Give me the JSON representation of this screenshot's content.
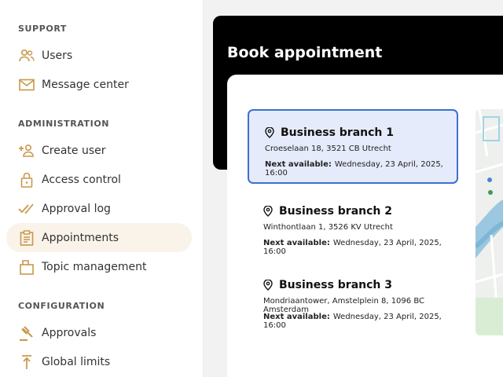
{
  "sidebar": {
    "sections": {
      "support": "SUPPORT",
      "administration": "ADMINISTRATION",
      "configuration": "CONFIGURATION"
    },
    "items": [
      {
        "label": "Users",
        "icon": "users-icon"
      },
      {
        "label": "Message center",
        "icon": "mail-icon"
      },
      {
        "label": "Create user",
        "icon": "add-user-icon"
      },
      {
        "label": "Access control",
        "icon": "lock-icon"
      },
      {
        "label": "Approval log",
        "icon": "double-check-icon"
      },
      {
        "label": "Appointments",
        "icon": "clipboard-icon"
      },
      {
        "label": "Topic management",
        "icon": "topic-icon"
      },
      {
        "label": "Approvals",
        "icon": "gavel-icon"
      },
      {
        "label": "Global limits",
        "icon": "limit-icon"
      }
    ],
    "active": "Appointments"
  },
  "main": {
    "title": "Book appointment",
    "next_label": "Next available:",
    "branches": [
      {
        "name": "Business branch 1",
        "address": "Croeselaan 18, 3521 CB Utrecht",
        "next": "Wednesday, 23 April, 2025, 16:00",
        "selected": true
      },
      {
        "name": "Business branch 2",
        "address": "Winthontlaan 1, 3526 KV Utrecht",
        "next": "Wednesday, 23 April, 2025, 16:00",
        "selected": false
      },
      {
        "name": "Business branch 3",
        "address": "Mondriaantower, Amstelplein 8, 1096 BC Amsterdam",
        "next": "Wednesday, 23 April, 2025, 16:00",
        "selected": false
      }
    ]
  },
  "colors": {
    "accent_icon": "#c9974a",
    "selected_bg": "#e6ebfb",
    "selected_border": "#3d6fd0",
    "active_nav_bg": "#f9f3ea",
    "header_bg": "#000000"
  }
}
